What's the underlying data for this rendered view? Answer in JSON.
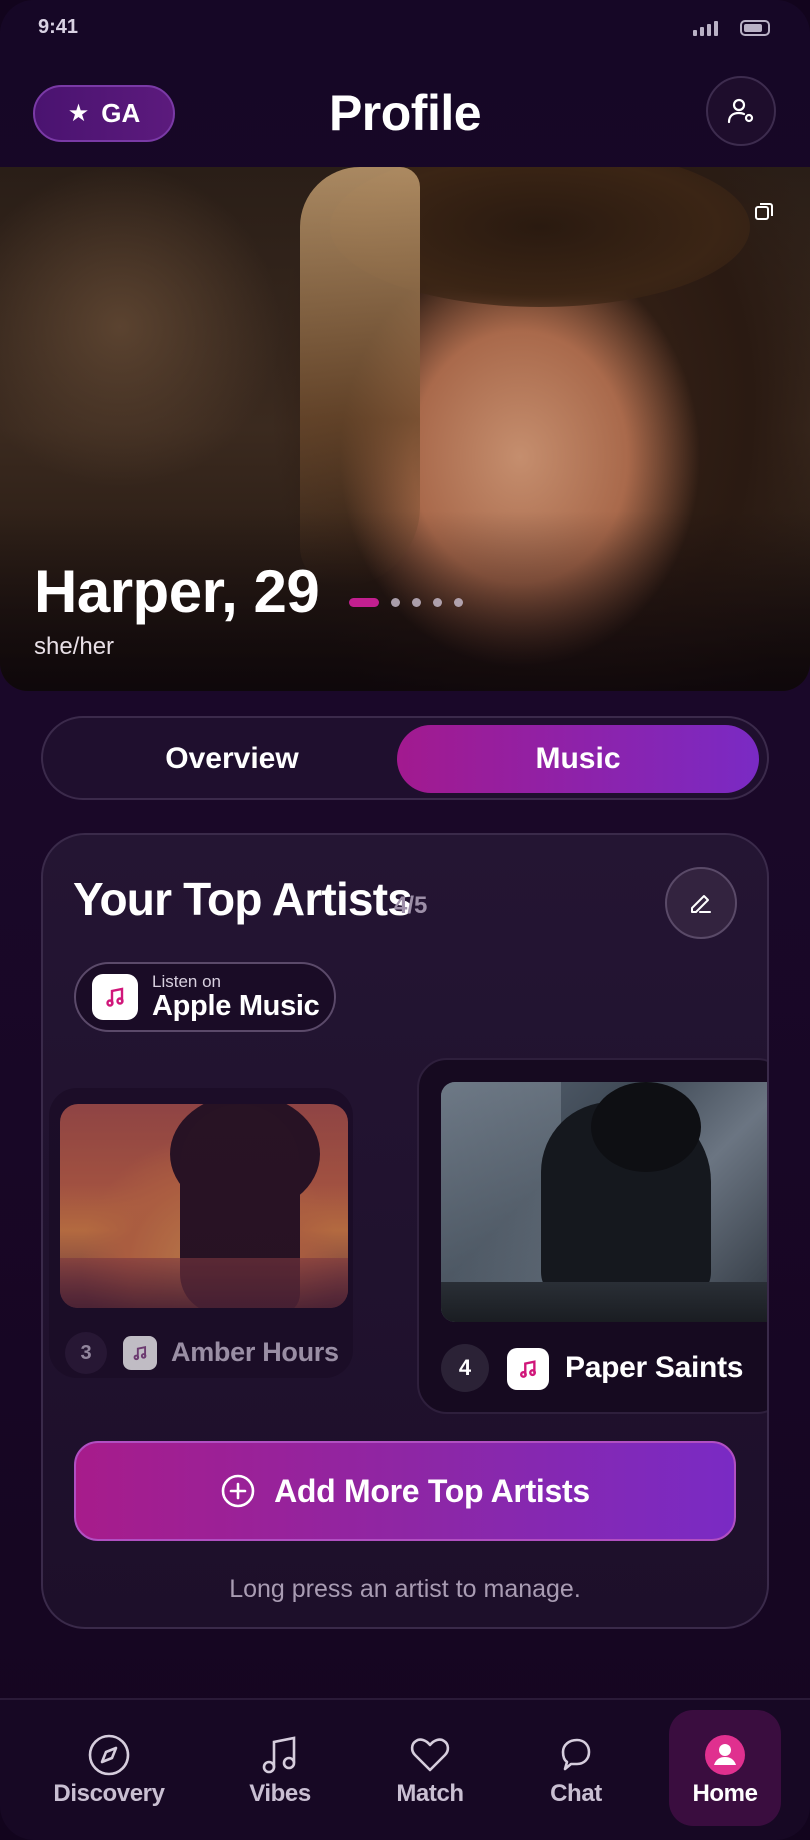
{
  "status_bar": {
    "time": "9:41"
  },
  "header": {
    "badge_label": "GA",
    "title": "Profile"
  },
  "profile": {
    "name_age": "Harper, 29",
    "pronouns": "she/her",
    "photo_count": 5,
    "active_photo": 1
  },
  "tabs": [
    {
      "label": "Overview",
      "selected": false
    },
    {
      "label": "Music",
      "selected": true
    }
  ],
  "top_artists": {
    "title": "Your Top Artists",
    "count": "4/5",
    "service_prefix": "Listen on",
    "service_name": "Apple Music",
    "artists": [
      {
        "rank": "3",
        "name": "Amber Hours"
      },
      {
        "rank": "4",
        "name": "Paper Saints"
      }
    ],
    "add_button": "Add More Top Artists",
    "hint": "Long press an artist to manage."
  },
  "nav": [
    {
      "label": "Discovery",
      "icon": "compass-icon"
    },
    {
      "label": "Vibes",
      "icon": "music-note-icon"
    },
    {
      "label": "Match",
      "icon": "heart-icon"
    },
    {
      "label": "Chat",
      "icon": "chat-icon"
    },
    {
      "label": "Home",
      "icon": "user-icon",
      "active": true
    }
  ],
  "colors": {
    "accent_pink": "#a71c8b",
    "accent_purple": "#7a2ac4",
    "background": "#160726"
  }
}
